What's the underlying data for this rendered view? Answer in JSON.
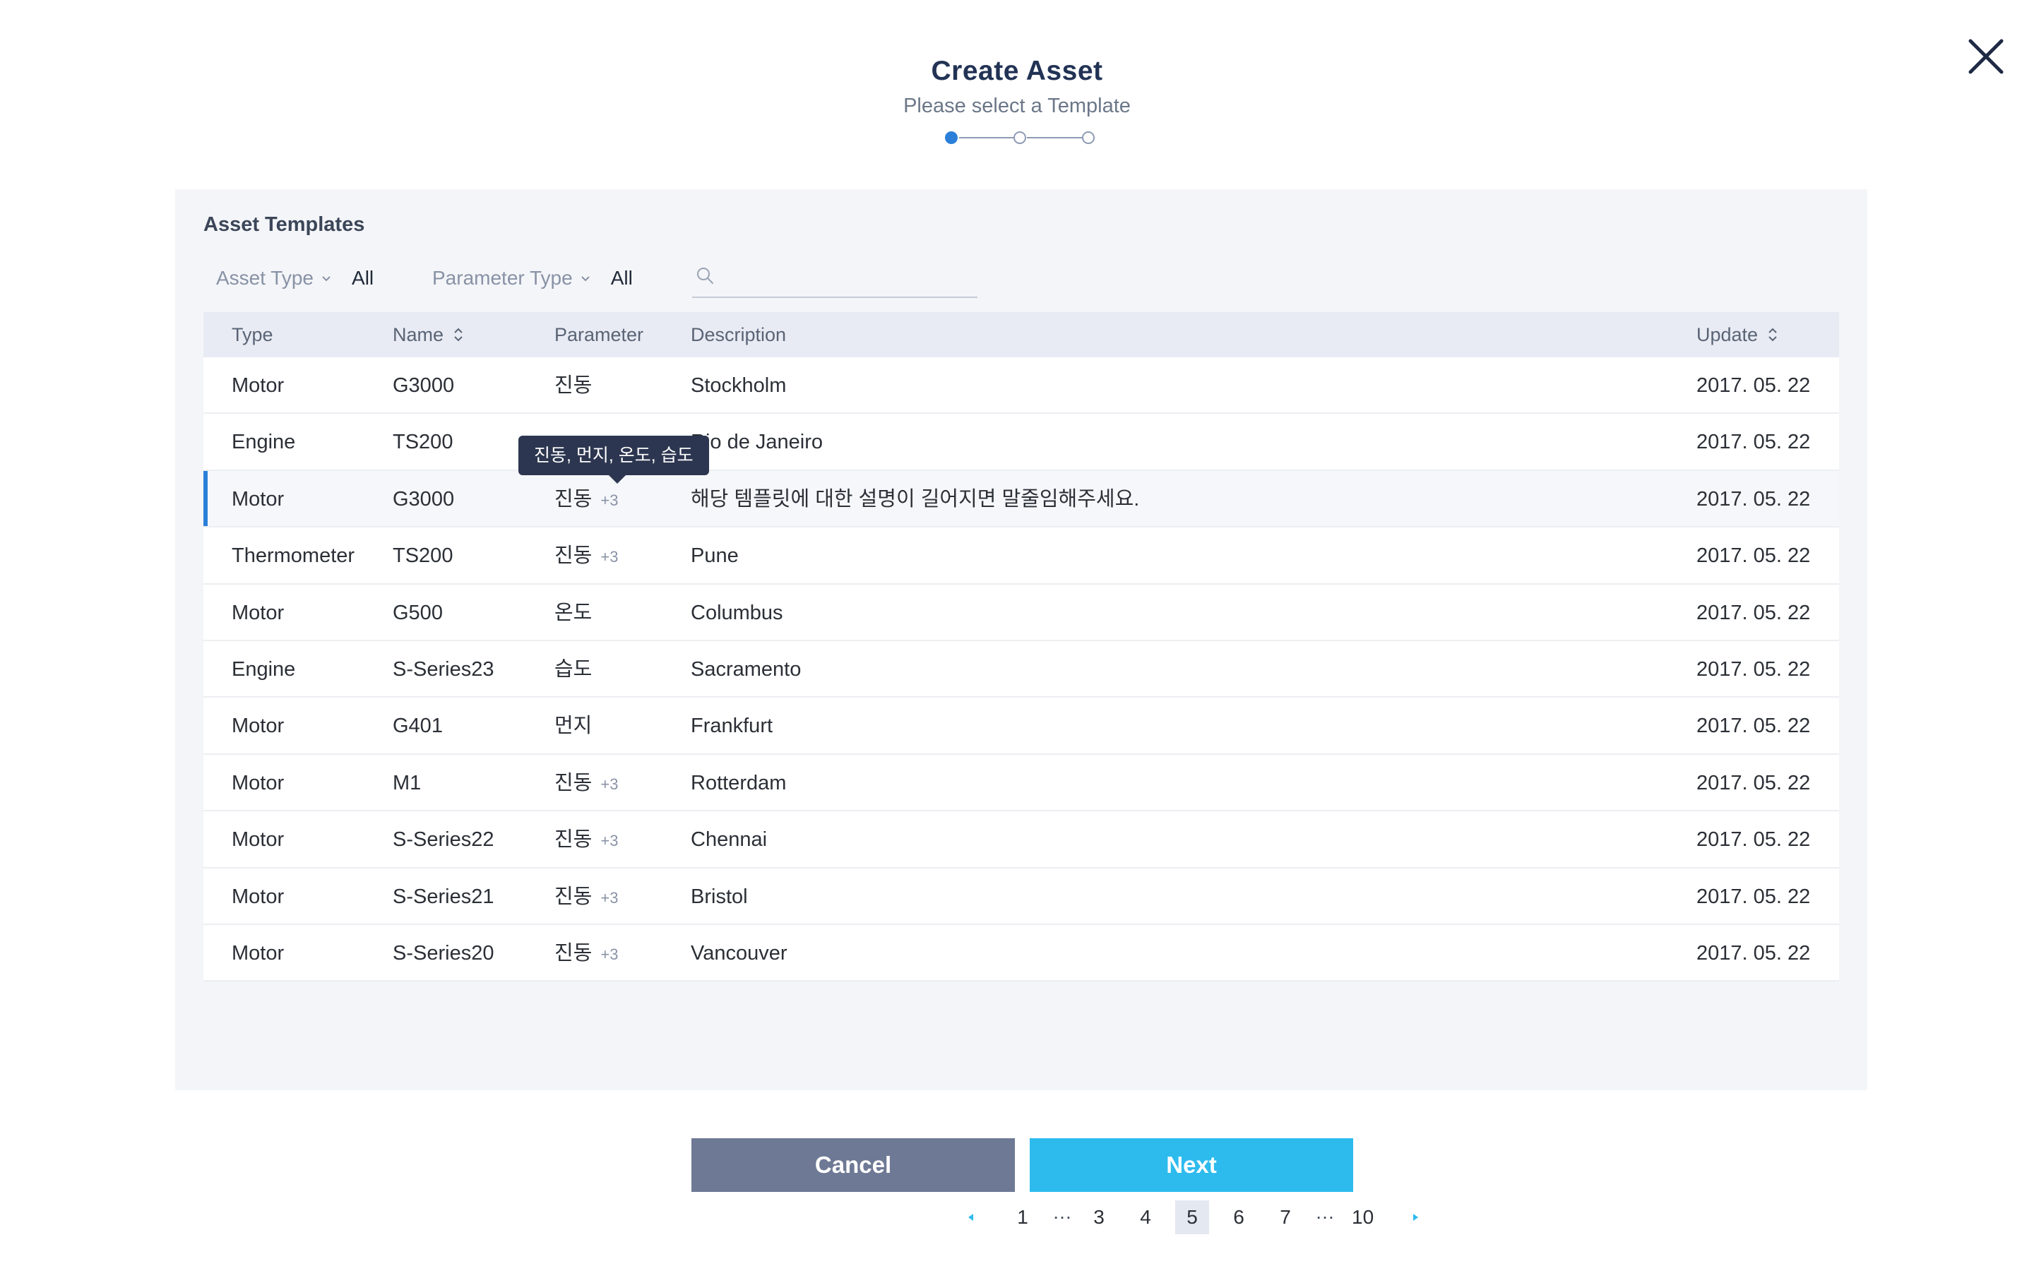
{
  "header": {
    "title": "Create Asset",
    "subtitle": "Please select a Template",
    "steps_total": 3,
    "current_step": 1
  },
  "panel": {
    "title": "Asset Templates",
    "filters": {
      "asset_type_label": "Asset Type",
      "asset_type_value": "All",
      "parameter_type_label": "Parameter Type",
      "parameter_type_value": "All"
    },
    "search": {
      "value": "",
      "placeholder": ""
    }
  },
  "table": {
    "columns": [
      "Type",
      "Name",
      "Parameter",
      "Description",
      "Update"
    ],
    "rows": [
      {
        "type": "Motor",
        "name": "G3000",
        "param": "진동",
        "param_extra": "",
        "desc": "Stockholm",
        "date": "2017. 05. 22"
      },
      {
        "type": "Engine",
        "name": "TS200",
        "param": "",
        "param_extra": "",
        "desc": "Rio de Janeiro",
        "date": "2017. 05. 22"
      },
      {
        "type": "Motor",
        "name": "G3000",
        "param": "진동",
        "param_extra": "+3",
        "desc": "해당 템플릿에 대한 설명이 길어지면 말줄임해주세요.",
        "date": "2017. 05. 22"
      },
      {
        "type": "Thermometer",
        "name": "TS200",
        "param": "진동",
        "param_extra": "+3",
        "desc": "Pune",
        "date": "2017. 05. 22"
      },
      {
        "type": "Motor",
        "name": "G500",
        "param": "온도",
        "param_extra": "",
        "desc": "Columbus",
        "date": "2017. 05. 22"
      },
      {
        "type": "Engine",
        "name": "S-Series23",
        "param": "습도",
        "param_extra": "",
        "desc": "Sacramento",
        "date": "2017. 05. 22"
      },
      {
        "type": "Motor",
        "name": "G401",
        "param": "먼지",
        "param_extra": "",
        "desc": "Frankfurt",
        "date": "2017. 05. 22"
      },
      {
        "type": "Motor",
        "name": "M1",
        "param": "진동",
        "param_extra": "+3",
        "desc": "Rotterdam",
        "date": "2017. 05. 22"
      },
      {
        "type": "Motor",
        "name": "S-Series22",
        "param": "진동",
        "param_extra": "+3",
        "desc": "Chennai",
        "date": "2017. 05. 22"
      },
      {
        "type": "Motor",
        "name": "S-Series21",
        "param": "진동",
        "param_extra": "+3",
        "desc": "Bristol",
        "date": "2017. 05. 22"
      },
      {
        "type": "Motor",
        "name": "S-Series20",
        "param": "진동",
        "param_extra": "+3",
        "desc": "Vancouver",
        "date": "2017. 05. 22"
      }
    ],
    "selected_row": 2,
    "tooltip": "진동, 먼지, 온도, 습도"
  },
  "pagination": {
    "pages": [
      "1",
      "…",
      "3",
      "4",
      "5",
      "6",
      "7",
      "…",
      "10"
    ],
    "current": "5"
  },
  "buttons": {
    "cancel": "Cancel",
    "next": "Next"
  },
  "colors": {
    "accent": "#2b7fd9",
    "next": "#2dbbee",
    "cancel": "#6e7995",
    "tooltip": "#2c3650"
  }
}
